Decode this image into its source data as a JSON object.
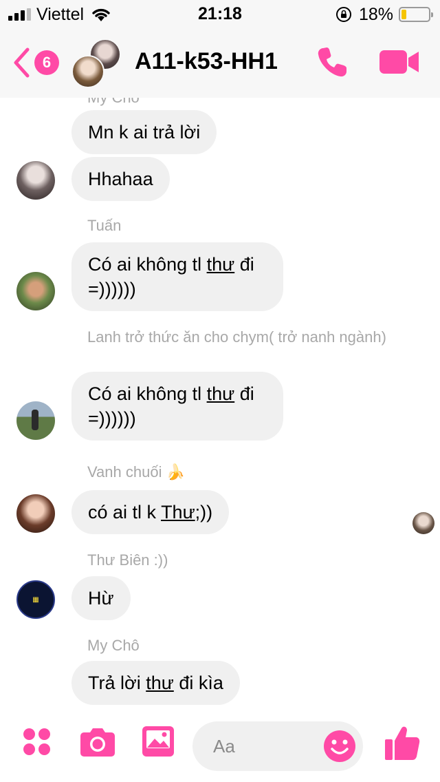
{
  "status_bar": {
    "carrier": "Viettel",
    "time": "21:18",
    "battery_percent": "18%",
    "battery_level": 0.18,
    "signal_bars": 3,
    "signal_max": 4
  },
  "header": {
    "back_badge": "6",
    "title": "A11-k53-HH1"
  },
  "messages": [
    {
      "sender": "My Chô",
      "text": "Mn k ai trả lời"
    },
    {
      "sender": "My Chô",
      "text": "Hhahaa"
    },
    {
      "sender": "Tuấn",
      "text_before": "Có ai không tl ",
      "text_underlined": "thư",
      "text_after": " đi",
      "text_line2": "=))))))"
    },
    {
      "sender": "Lanh trở thức ăn cho chym( trở nanh ngành)",
      "text_before": "Có ai không tl ",
      "text_underlined": "thư",
      "text_after": " đi",
      "text_line2": "=))))))"
    },
    {
      "sender": "Vanh chuối 🍌",
      "text_before": "có ai tl k ",
      "text_underlined": "Thư",
      "text_after": ";))"
    },
    {
      "sender": "Thư Biên :))",
      "text": "Hừ"
    },
    {
      "sender": "My Chô",
      "text_before": "Trả lời ",
      "text_underlined": "thư",
      "text_after": " đi kìa"
    }
  ],
  "composer": {
    "placeholder": "Aa"
  },
  "colors": {
    "accent": "#ff4aa6",
    "bubble": "#f0f0f0",
    "sender_label": "#a8a8a8"
  },
  "icons": [
    "signal-icon",
    "wifi-icon",
    "orientation-lock-icon",
    "battery-icon",
    "back-chevron-icon",
    "phone-icon",
    "video-camera-icon",
    "menu-dots-icon",
    "camera-icon",
    "image-icon",
    "emoji-icon",
    "thumbs-up-icon"
  ]
}
